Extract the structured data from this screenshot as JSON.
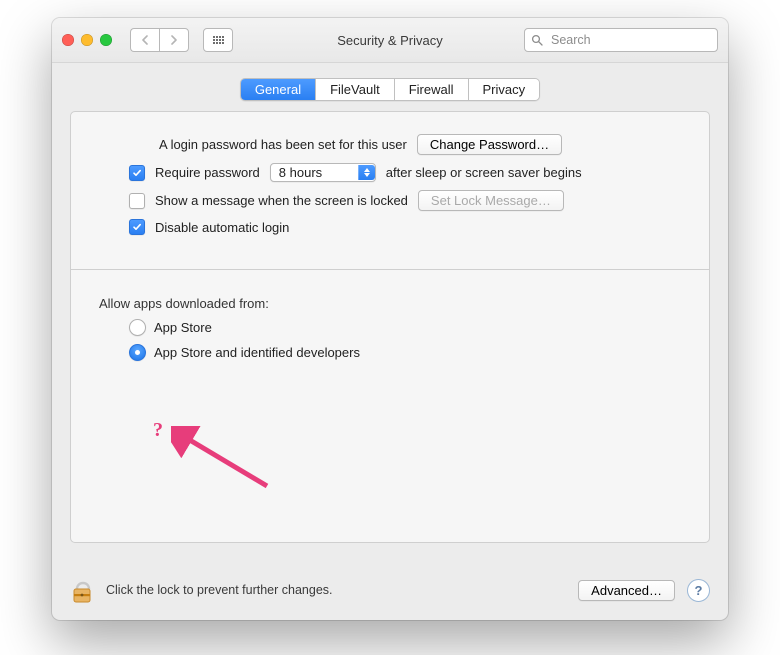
{
  "window": {
    "title": "Security & Privacy"
  },
  "search": {
    "placeholder": "Search"
  },
  "tabs": [
    {
      "label": "General",
      "active": true
    },
    {
      "label": "FileVault",
      "active": false
    },
    {
      "label": "Firewall",
      "active": false
    },
    {
      "label": "Privacy",
      "active": false
    }
  ],
  "login_password": {
    "text": "A login password has been set for this user",
    "change_button": "Change Password…"
  },
  "require_password": {
    "checked": true,
    "label_before": "Require password",
    "select_value": "8 hours",
    "label_after": "after sleep or screen saver begins"
  },
  "show_message": {
    "checked": false,
    "label": "Show a message when the screen is locked",
    "button": "Set Lock Message…"
  },
  "disable_auto_login": {
    "checked": true,
    "label": "Disable automatic login"
  },
  "allow_apps": {
    "title": "Allow apps downloaded from:",
    "options": [
      {
        "label": "App Store",
        "selected": false
      },
      {
        "label": "App Store and identified developers",
        "selected": true
      }
    ]
  },
  "annotation": {
    "mark": "?"
  },
  "footer": {
    "lock_tip": "Click the lock to prevent further changes.",
    "advanced_button": "Advanced…",
    "help": "?"
  }
}
